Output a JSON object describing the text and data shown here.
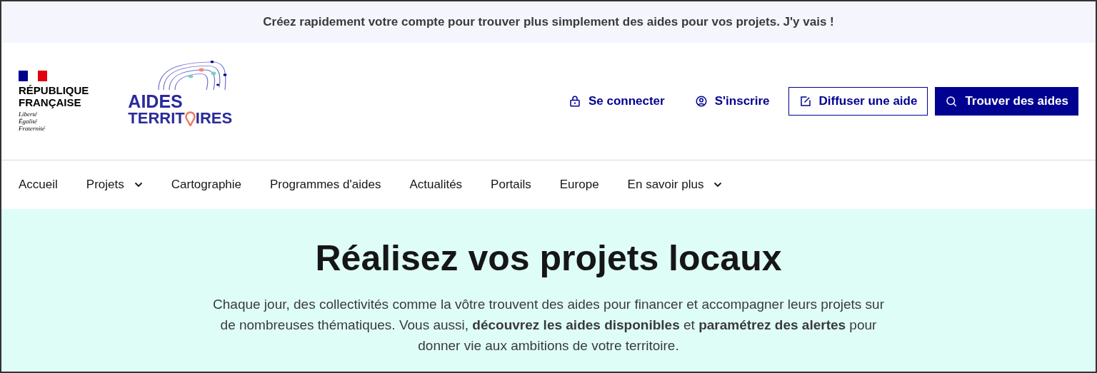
{
  "banner": {
    "text": "Créez rapidement votre compte pour trouver plus simplement des aides pour vos projets. J'y vais !"
  },
  "header": {
    "marianne": {
      "name_lines": [
        "RÉPUBLIQUE",
        "FRANÇAISE"
      ],
      "motto": [
        "Liberté",
        "Égalité",
        "Fraternité"
      ]
    },
    "logo": {
      "line1": "AIDES",
      "line2_start": "TERRIT",
      "line2_end": "IRES"
    },
    "actions": [
      {
        "kind": "link",
        "label": "Se connecter"
      },
      {
        "kind": "link",
        "label": "S'inscrire"
      },
      {
        "kind": "secondary",
        "label": "Diffuser une aide"
      },
      {
        "kind": "primary",
        "label": "Trouver des aides"
      }
    ]
  },
  "nav": [
    {
      "label": "Accueil",
      "expandable": false
    },
    {
      "label": "Projets",
      "expandable": true
    },
    {
      "label": "Cartographie",
      "expandable": false
    },
    {
      "label": "Programmes d'aides",
      "expandable": false
    },
    {
      "label": "Actualités",
      "expandable": false
    },
    {
      "label": "Portails",
      "expandable": false
    },
    {
      "label": "Europe",
      "expandable": false
    },
    {
      "label": "En savoir plus",
      "expandable": true
    }
  ],
  "hero": {
    "title": "Réalisez vos projets locaux",
    "text": "Chaque jour, des collectivités comme la vôtre trouvent des aides pour financer et accompagner leurs projets sur de nombreuses thématiques. Vous aussi, **découvrez les aides disponibles** et **paramétrez des alertes** pour donner vie aux ambitions de votre territoire."
  }
}
